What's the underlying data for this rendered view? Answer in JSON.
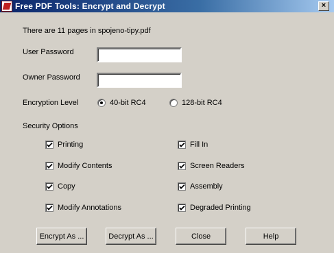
{
  "window": {
    "title": "Free PDF Tools:  Encrypt and Decrypt",
    "close_glyph": "×"
  },
  "info": {
    "page_count_text": "There are 11 pages in spojeno-tipy.pdf"
  },
  "fields": {
    "user_password_label": "User Password",
    "user_password_value": "",
    "owner_password_label": "Owner Password",
    "owner_password_value": ""
  },
  "encryption": {
    "label": "Encryption Level",
    "options": [
      {
        "label": "40-bit RC4",
        "selected": true
      },
      {
        "label": "128-bit RC4",
        "selected": false
      }
    ]
  },
  "security": {
    "label": "Security Options",
    "options": [
      {
        "label": "Printing",
        "checked": true
      },
      {
        "label": "Fill In",
        "checked": true
      },
      {
        "label": "Modify Contents",
        "checked": true
      },
      {
        "label": "Screen Readers",
        "checked": true
      },
      {
        "label": "Copy",
        "checked": true
      },
      {
        "label": "Assembly",
        "checked": true
      },
      {
        "label": "Modify Annotations",
        "checked": true
      },
      {
        "label": "Degraded Printing",
        "checked": true
      }
    ]
  },
  "buttons": {
    "encrypt": "Encrypt As ...",
    "decrypt": "Decrypt As ...",
    "close": "Close",
    "help": "Help"
  }
}
